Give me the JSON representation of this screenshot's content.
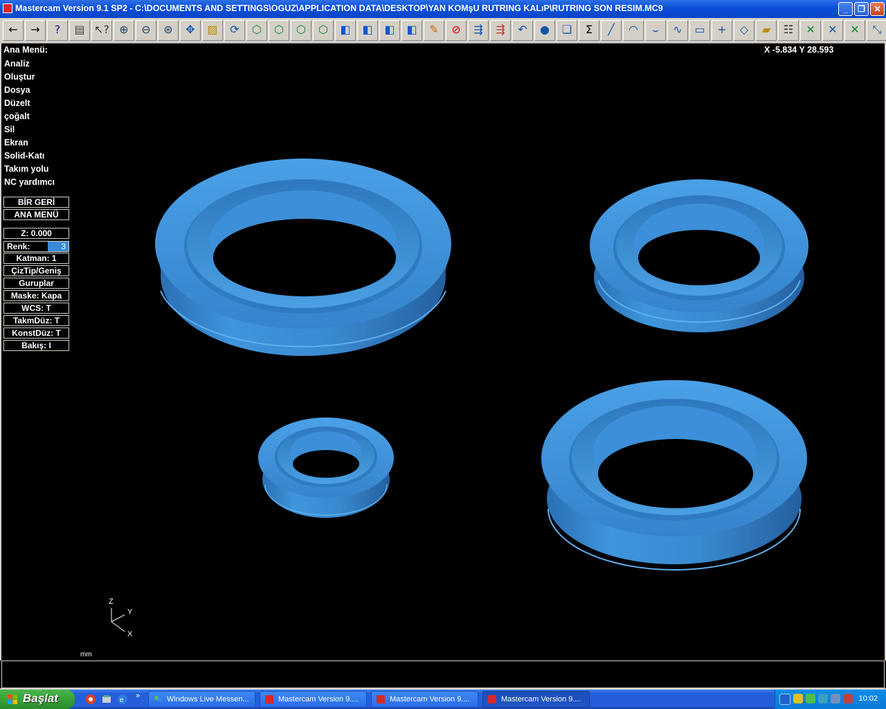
{
  "window": {
    "title": "Mastercam Version 9.1 SP2 - C:\\DOCUMENTS AND SETTINGS\\OGUZ\\APPLICATION DATA\\DESKTOP\\YAN KOMşU RUTRING KALıP\\RUTRING SON RESIM.MC9",
    "minimize": "_",
    "restore": "❐",
    "close": "✕"
  },
  "toolbar": {
    "icons": [
      "back-arrow-icon",
      "forward-arrow-icon",
      "help-icon",
      "calculator-icon",
      "query-icon",
      "zoom-window-icon",
      "unzoom-icon",
      "zoom-8-icon",
      "pan-icon",
      "select-icon",
      "rotate-icon",
      "view-top-icon",
      "view-front-icon",
      "view-side-icon",
      "view-iso-icon",
      "cube-top-icon",
      "cube-front-icon",
      "cube-side-icon",
      "cube-iso-icon",
      "pencil-icon",
      "no-entry-icon",
      "transform-icon",
      "transform2-icon",
      "undo-arc-icon",
      "sphere-icon",
      "group-icon",
      "sigma-icon",
      "line-icon",
      "arc-icon",
      "fillet-icon",
      "spline-icon",
      "rectangle-icon",
      "point-icon",
      "surface-icon",
      "solid-box-icon",
      "ladder-icon",
      "trim-icon",
      "trim2-icon",
      "break-icon",
      "divide-icon"
    ]
  },
  "menu": {
    "title": "Ana Menü:",
    "items": [
      "Analiz",
      "Oluştur",
      "Dosya",
      "Düzelt",
      "çoğalt",
      "Sil",
      "Ekran",
      "Solid-Katı",
      "Takım yolu",
      "NC yardımcı"
    ]
  },
  "buttons": {
    "back": "BİR GERİ",
    "main": "ANA MENÜ"
  },
  "status": {
    "z": "Z:   0.000",
    "renk_label": "Renk:",
    "renk_value": "3",
    "katman": "Katman:  1",
    "ciztip": "ÇizTip/Geniş",
    "guruplar": "Guruplar",
    "maske": "Maske:  Kapa",
    "wcs": "WCS:   T",
    "takmduz": "TakmDüz:  T",
    "konstduz": "KonstDüz:  T",
    "bakis": "Bakış:   I"
  },
  "coords": "X -5.834  Y 28.593",
  "axes": {
    "z": "Z",
    "y": "Y",
    "x": "X"
  },
  "unit": "mm",
  "colors": {
    "part": "#3d8fd6",
    "part_dark": "#1f5f9e",
    "background": "#000000"
  },
  "taskbar": {
    "start": "Başlat",
    "tasks": [
      "Windows Live Messen...",
      "Mastercam Version 9....",
      "Mastercam Version 9....",
      "Mastercam Version 9...."
    ],
    "clock": "10:02"
  }
}
